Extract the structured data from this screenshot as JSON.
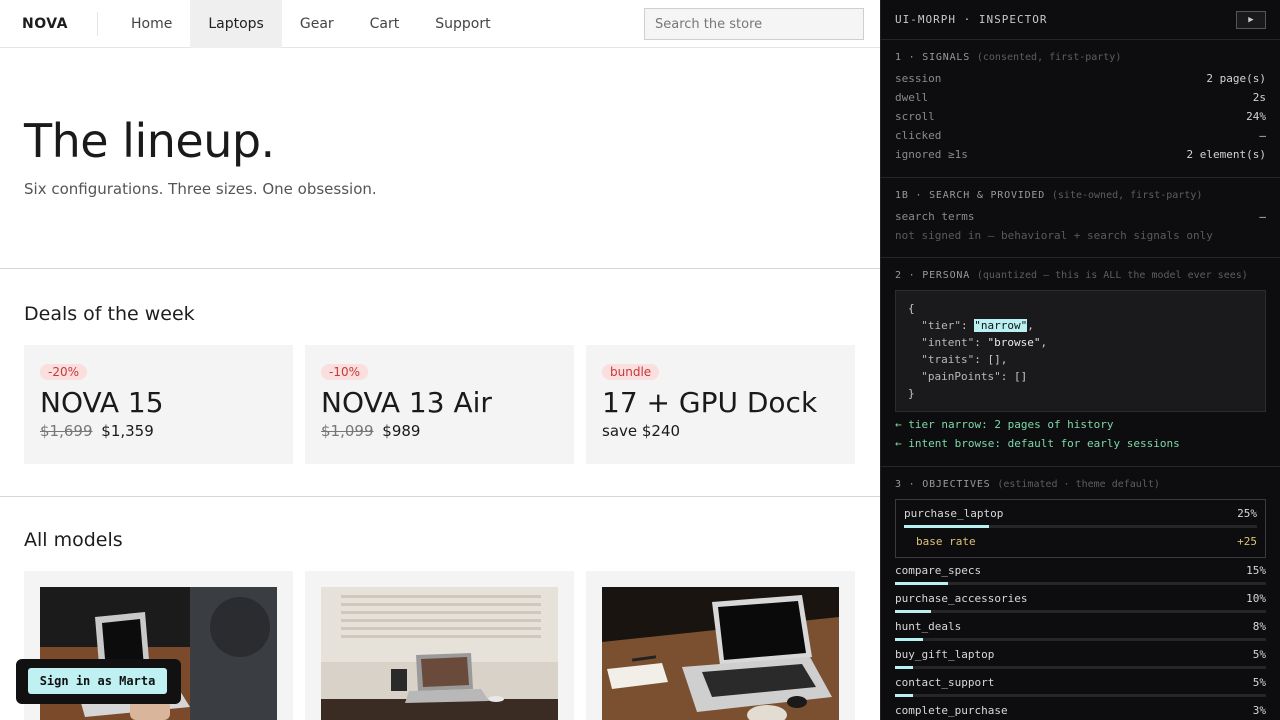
{
  "store": {
    "logo": "NOVA",
    "nav": [
      "Home",
      "Laptops",
      "Gear",
      "Cart",
      "Support"
    ],
    "search_placeholder": "Search the store",
    "hero": {
      "title": "The lineup.",
      "subtitle": "Six configurations. Three sizes. One obsession."
    },
    "deals": {
      "title": "Deals of the week",
      "items": [
        {
          "badge": "-20%",
          "name": "NOVA 15",
          "old_price": "$1,699",
          "price": "$1,359"
        },
        {
          "badge": "-10%",
          "name": "NOVA 13 Air",
          "old_price": "$1,099",
          "price": "$989"
        },
        {
          "badge": "bundle",
          "name": "17 + GPU Dock",
          "old_price": "",
          "price": "save $240"
        }
      ]
    },
    "models": {
      "title": "All models"
    },
    "signin_label": "Sign in as Marta"
  },
  "inspector": {
    "title": "UI-MORPH · INSPECTOR",
    "play_icon": "▶",
    "signals": {
      "heading": "1 · SIGNALS",
      "sub": "(consented, first-party)",
      "rows": [
        {
          "k": "session",
          "v": "2 page(s)"
        },
        {
          "k": "dwell",
          "v": "2s"
        },
        {
          "k": "scroll",
          "v": "24%"
        },
        {
          "k": "clicked",
          "v": "—"
        },
        {
          "k": "ignored ≥1s",
          "v": "2 element(s)"
        }
      ]
    },
    "search": {
      "heading": "1B · SEARCH & PROVIDED",
      "sub": "(site-owned, first-party)",
      "row_k": "search terms",
      "row_v": "—",
      "note": "not signed in — behavioral + search signals only"
    },
    "persona": {
      "heading": "2 · PERSONA",
      "sub": "(quantized — this is ALL the model ever sees)",
      "tier": "\"narrow\"",
      "intent": "\"browse\"",
      "notes": [
        "← tier narrow: 2 pages of history",
        "← intent browse: default for early sessions"
      ]
    },
    "objectives": {
      "heading": "3 · OBJECTIVES",
      "sub": "(estimated · theme default)",
      "main": {
        "name": "purchase_laptop",
        "pct": "25%",
        "value": 25,
        "base_label": "base rate",
        "base_value": "+25"
      },
      "items": [
        {
          "name": "compare_specs",
          "pct": "15%",
          "value": 15
        },
        {
          "name": "purchase_accessories",
          "pct": "10%",
          "value": 10
        },
        {
          "name": "hunt_deals",
          "pct": "8%",
          "value": 8
        },
        {
          "name": "buy_gift_laptop",
          "pct": "5%",
          "value": 5
        },
        {
          "name": "contact_support",
          "pct": "5%",
          "value": 5
        },
        {
          "name": "complete_purchase",
          "pct": "3%",
          "value": 3
        }
      ]
    }
  }
}
